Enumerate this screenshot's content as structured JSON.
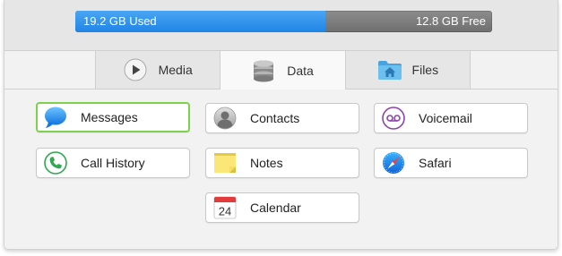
{
  "storage": {
    "used_label": "19.2 GB Used",
    "free_label": "12.8 GB Free",
    "used_fraction": 0.6,
    "used_color": "#2a8ff0",
    "free_color": "#7a7a7a"
  },
  "tabs": [
    {
      "label": "Media",
      "icon": "play-icon",
      "active": false
    },
    {
      "label": "Data",
      "icon": "database-icon",
      "active": true
    },
    {
      "label": "Files",
      "icon": "folder-home-icon",
      "active": false
    }
  ],
  "buttons": [
    {
      "label": "Messages",
      "icon": "messages-icon",
      "selected": true
    },
    {
      "label": "Contacts",
      "icon": "contacts-icon",
      "selected": false
    },
    {
      "label": "Voicemail",
      "icon": "voicemail-icon",
      "selected": false
    },
    {
      "label": "Call History",
      "icon": "phone-icon",
      "selected": false
    },
    {
      "label": "Notes",
      "icon": "notes-icon",
      "selected": false
    },
    {
      "label": "Safari",
      "icon": "safari-compass-icon",
      "selected": false
    },
    {
      "label": "Calendar",
      "icon": "calendar-icon",
      "selected": false
    }
  ],
  "calendar_day": "24",
  "colors": {
    "selected_border": "#7ed14b"
  }
}
